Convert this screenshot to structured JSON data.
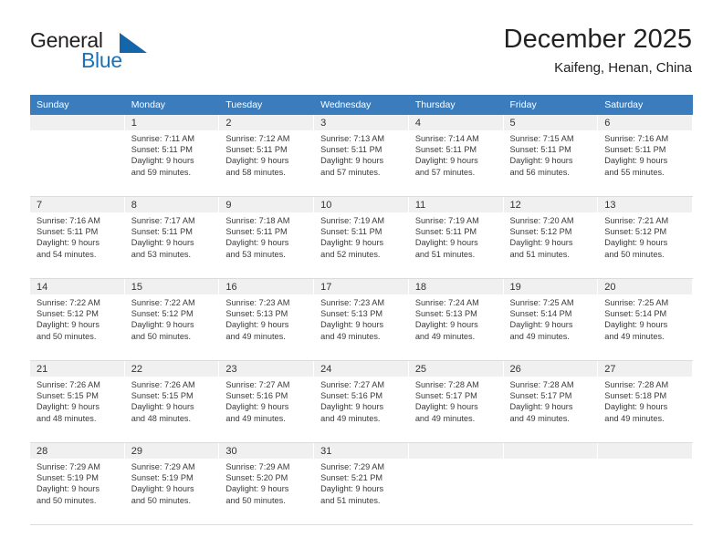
{
  "brand": {
    "name_top": "General",
    "name_bottom": "Blue",
    "triangle_color": "#1565ab",
    "blue_color": "#1c72b8"
  },
  "header": {
    "title": "December 2025",
    "subtitle": "Kaifeng, Henan, China"
  },
  "theme": {
    "header_row_bg": "#3b7cbd",
    "daynum_bg": "#f0f0f0",
    "text": "#3a3a3a"
  },
  "weekdays": [
    "Sunday",
    "Monday",
    "Tuesday",
    "Wednesday",
    "Thursday",
    "Friday",
    "Saturday"
  ],
  "labels": {
    "sunrise_prefix": "Sunrise:",
    "sunset_prefix": "Sunset:",
    "daylight_prefix": "Daylight:"
  },
  "weeks": [
    [
      {
        "day": "",
        "l1": "",
        "l2": "",
        "l3": "",
        "l4": ""
      },
      {
        "day": "1",
        "l1": "Sunrise: 7:11 AM",
        "l2": "Sunset: 5:11 PM",
        "l3": "Daylight: 9 hours",
        "l4": "and 59 minutes."
      },
      {
        "day": "2",
        "l1": "Sunrise: 7:12 AM",
        "l2": "Sunset: 5:11 PM",
        "l3": "Daylight: 9 hours",
        "l4": "and 58 minutes."
      },
      {
        "day": "3",
        "l1": "Sunrise: 7:13 AM",
        "l2": "Sunset: 5:11 PM",
        "l3": "Daylight: 9 hours",
        "l4": "and 57 minutes."
      },
      {
        "day": "4",
        "l1": "Sunrise: 7:14 AM",
        "l2": "Sunset: 5:11 PM",
        "l3": "Daylight: 9 hours",
        "l4": "and 57 minutes."
      },
      {
        "day": "5",
        "l1": "Sunrise: 7:15 AM",
        "l2": "Sunset: 5:11 PM",
        "l3": "Daylight: 9 hours",
        "l4": "and 56 minutes."
      },
      {
        "day": "6",
        "l1": "Sunrise: 7:16 AM",
        "l2": "Sunset: 5:11 PM",
        "l3": "Daylight: 9 hours",
        "l4": "and 55 minutes."
      }
    ],
    [
      {
        "day": "7",
        "l1": "Sunrise: 7:16 AM",
        "l2": "Sunset: 5:11 PM",
        "l3": "Daylight: 9 hours",
        "l4": "and 54 minutes."
      },
      {
        "day": "8",
        "l1": "Sunrise: 7:17 AM",
        "l2": "Sunset: 5:11 PM",
        "l3": "Daylight: 9 hours",
        "l4": "and 53 minutes."
      },
      {
        "day": "9",
        "l1": "Sunrise: 7:18 AM",
        "l2": "Sunset: 5:11 PM",
        "l3": "Daylight: 9 hours",
        "l4": "and 53 minutes."
      },
      {
        "day": "10",
        "l1": "Sunrise: 7:19 AM",
        "l2": "Sunset: 5:11 PM",
        "l3": "Daylight: 9 hours",
        "l4": "and 52 minutes."
      },
      {
        "day": "11",
        "l1": "Sunrise: 7:19 AM",
        "l2": "Sunset: 5:11 PM",
        "l3": "Daylight: 9 hours",
        "l4": "and 51 minutes."
      },
      {
        "day": "12",
        "l1": "Sunrise: 7:20 AM",
        "l2": "Sunset: 5:12 PM",
        "l3": "Daylight: 9 hours",
        "l4": "and 51 minutes."
      },
      {
        "day": "13",
        "l1": "Sunrise: 7:21 AM",
        "l2": "Sunset: 5:12 PM",
        "l3": "Daylight: 9 hours",
        "l4": "and 50 minutes."
      }
    ],
    [
      {
        "day": "14",
        "l1": "Sunrise: 7:22 AM",
        "l2": "Sunset: 5:12 PM",
        "l3": "Daylight: 9 hours",
        "l4": "and 50 minutes."
      },
      {
        "day": "15",
        "l1": "Sunrise: 7:22 AM",
        "l2": "Sunset: 5:12 PM",
        "l3": "Daylight: 9 hours",
        "l4": "and 50 minutes."
      },
      {
        "day": "16",
        "l1": "Sunrise: 7:23 AM",
        "l2": "Sunset: 5:13 PM",
        "l3": "Daylight: 9 hours",
        "l4": "and 49 minutes."
      },
      {
        "day": "17",
        "l1": "Sunrise: 7:23 AM",
        "l2": "Sunset: 5:13 PM",
        "l3": "Daylight: 9 hours",
        "l4": "and 49 minutes."
      },
      {
        "day": "18",
        "l1": "Sunrise: 7:24 AM",
        "l2": "Sunset: 5:13 PM",
        "l3": "Daylight: 9 hours",
        "l4": "and 49 minutes."
      },
      {
        "day": "19",
        "l1": "Sunrise: 7:25 AM",
        "l2": "Sunset: 5:14 PM",
        "l3": "Daylight: 9 hours",
        "l4": "and 49 minutes."
      },
      {
        "day": "20",
        "l1": "Sunrise: 7:25 AM",
        "l2": "Sunset: 5:14 PM",
        "l3": "Daylight: 9 hours",
        "l4": "and 49 minutes."
      }
    ],
    [
      {
        "day": "21",
        "l1": "Sunrise: 7:26 AM",
        "l2": "Sunset: 5:15 PM",
        "l3": "Daylight: 9 hours",
        "l4": "and 48 minutes."
      },
      {
        "day": "22",
        "l1": "Sunrise: 7:26 AM",
        "l2": "Sunset: 5:15 PM",
        "l3": "Daylight: 9 hours",
        "l4": "and 48 minutes."
      },
      {
        "day": "23",
        "l1": "Sunrise: 7:27 AM",
        "l2": "Sunset: 5:16 PM",
        "l3": "Daylight: 9 hours",
        "l4": "and 49 minutes."
      },
      {
        "day": "24",
        "l1": "Sunrise: 7:27 AM",
        "l2": "Sunset: 5:16 PM",
        "l3": "Daylight: 9 hours",
        "l4": "and 49 minutes."
      },
      {
        "day": "25",
        "l1": "Sunrise: 7:28 AM",
        "l2": "Sunset: 5:17 PM",
        "l3": "Daylight: 9 hours",
        "l4": "and 49 minutes."
      },
      {
        "day": "26",
        "l1": "Sunrise: 7:28 AM",
        "l2": "Sunset: 5:17 PM",
        "l3": "Daylight: 9 hours",
        "l4": "and 49 minutes."
      },
      {
        "day": "27",
        "l1": "Sunrise: 7:28 AM",
        "l2": "Sunset: 5:18 PM",
        "l3": "Daylight: 9 hours",
        "l4": "and 49 minutes."
      }
    ],
    [
      {
        "day": "28",
        "l1": "Sunrise: 7:29 AM",
        "l2": "Sunset: 5:19 PM",
        "l3": "Daylight: 9 hours",
        "l4": "and 50 minutes."
      },
      {
        "day": "29",
        "l1": "Sunrise: 7:29 AM",
        "l2": "Sunset: 5:19 PM",
        "l3": "Daylight: 9 hours",
        "l4": "and 50 minutes."
      },
      {
        "day": "30",
        "l1": "Sunrise: 7:29 AM",
        "l2": "Sunset: 5:20 PM",
        "l3": "Daylight: 9 hours",
        "l4": "and 50 minutes."
      },
      {
        "day": "31",
        "l1": "Sunrise: 7:29 AM",
        "l2": "Sunset: 5:21 PM",
        "l3": "Daylight: 9 hours",
        "l4": "and 51 minutes."
      },
      {
        "day": "",
        "l1": "",
        "l2": "",
        "l3": "",
        "l4": ""
      },
      {
        "day": "",
        "l1": "",
        "l2": "",
        "l3": "",
        "l4": ""
      },
      {
        "day": "",
        "l1": "",
        "l2": "",
        "l3": "",
        "l4": ""
      }
    ]
  ]
}
